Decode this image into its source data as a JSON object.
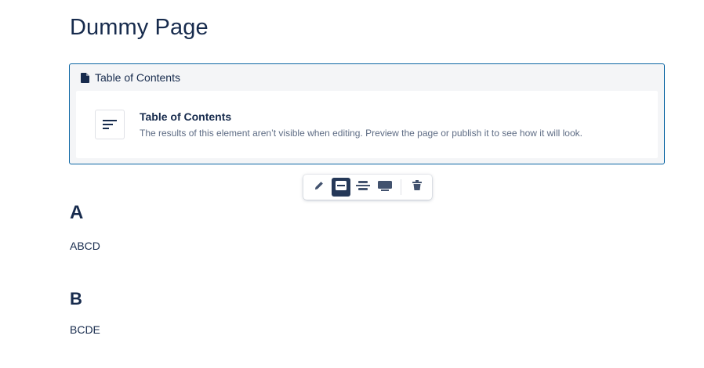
{
  "page": {
    "title": "Dummy Page"
  },
  "macro": {
    "header_label": "Table of Contents",
    "header_icon": "document-icon",
    "title": "Table of Contents",
    "description": "The results of this element aren’t visible when editing. Preview the page or publish it to see how it will look.",
    "icon": "toc-lines-icon",
    "border_color": "#0c66a4"
  },
  "toolbar": {
    "buttons": [
      {
        "icon": "pencil-icon",
        "active": false
      },
      {
        "icon": "layout-default-icon",
        "active": true
      },
      {
        "icon": "layout-wide-icon",
        "active": false
      },
      {
        "icon": "layout-full-width-icon",
        "active": false
      },
      {
        "icon": "trash-icon",
        "active": false
      }
    ]
  },
  "content": {
    "sections": [
      {
        "heading": "A",
        "text": "ABCD"
      },
      {
        "heading": "B",
        "text": "BCDE"
      }
    ]
  }
}
